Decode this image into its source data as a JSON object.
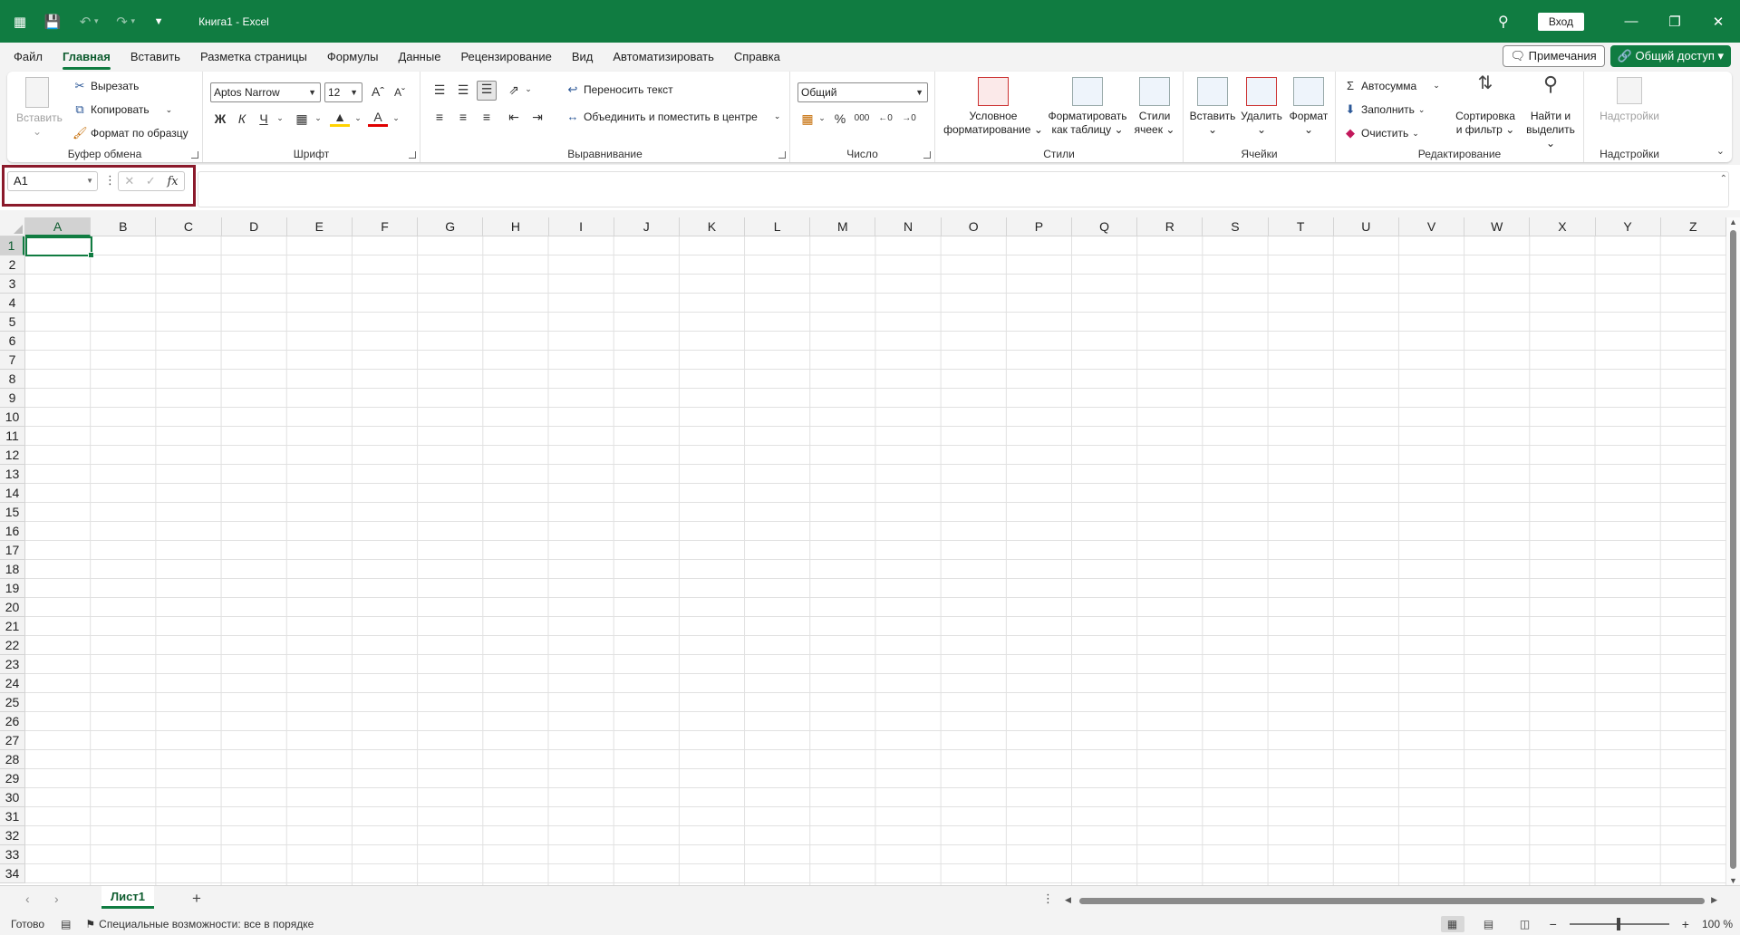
{
  "window": {
    "title": "Книга1 - Excel",
    "sign_in": "Вход"
  },
  "menu": {
    "tabs": [
      "Файл",
      "Главная",
      "Вставить",
      "Разметка страницы",
      "Формулы",
      "Данные",
      "Рецензирование",
      "Вид",
      "Автоматизировать",
      "Справка"
    ],
    "active": "Главная",
    "comments": "Примечания",
    "share": "Общий доступ"
  },
  "ribbon": {
    "clipboard": {
      "label": "Буфер обмена",
      "paste": "Вставить",
      "cut": "Вырезать",
      "copy": "Копировать",
      "format_painter": "Формат по образцу"
    },
    "font": {
      "label": "Шрифт",
      "font_name": "Aptos Narrow",
      "font_size": "12",
      "bold": "Ж",
      "italic": "К",
      "underline": "Ч"
    },
    "alignment": {
      "label": "Выравнивание",
      "wrap": "Переносить текст",
      "merge": "Объединить и поместить в центре"
    },
    "number": {
      "label": "Число",
      "format": "Общий"
    },
    "styles": {
      "label": "Стили",
      "conditional": "Условное форматирование",
      "as_table": "Форматировать как таблицу",
      "cell_styles": "Стили ячеек"
    },
    "cells": {
      "label": "Ячейки",
      "insert": "Вставить",
      "delete": "Удалить",
      "format": "Формат"
    },
    "editing": {
      "label": "Редактирование",
      "autosum": "Автосумма",
      "fill": "Заполнить",
      "clear": "Очистить",
      "sort_filter": "Сортировка и фильтр",
      "find_select": "Найти и выделить"
    },
    "addins": {
      "label": "Надстройки",
      "addins": "Надстройки"
    }
  },
  "formula_bar": {
    "name_box": "A1",
    "fx": "fx",
    "value": ""
  },
  "grid": {
    "columns": [
      "A",
      "B",
      "C",
      "D",
      "E",
      "F",
      "G",
      "H",
      "I",
      "J",
      "K",
      "L",
      "M",
      "N",
      "O",
      "P",
      "Q",
      "R",
      "S",
      "T",
      "U",
      "V",
      "W",
      "X",
      "Y",
      "Z"
    ],
    "rows": [
      "1",
      "2",
      "3",
      "4",
      "5",
      "6",
      "7",
      "8",
      "9",
      "10",
      "11",
      "12",
      "13",
      "14",
      "15",
      "16",
      "17",
      "18",
      "19",
      "20",
      "21",
      "22",
      "23",
      "24",
      "25",
      "26",
      "27",
      "28",
      "29",
      "30",
      "31",
      "32",
      "33",
      "34"
    ],
    "selected_cell": "A1"
  },
  "sheets": {
    "tabs": [
      "Лист1"
    ],
    "active": "Лист1"
  },
  "status": {
    "ready": "Готово",
    "accessibility": "Специальные возможности: все в порядке",
    "zoom": "100 %"
  },
  "colors": {
    "brand": "#107c41",
    "highlight": "#8b1a2b"
  }
}
